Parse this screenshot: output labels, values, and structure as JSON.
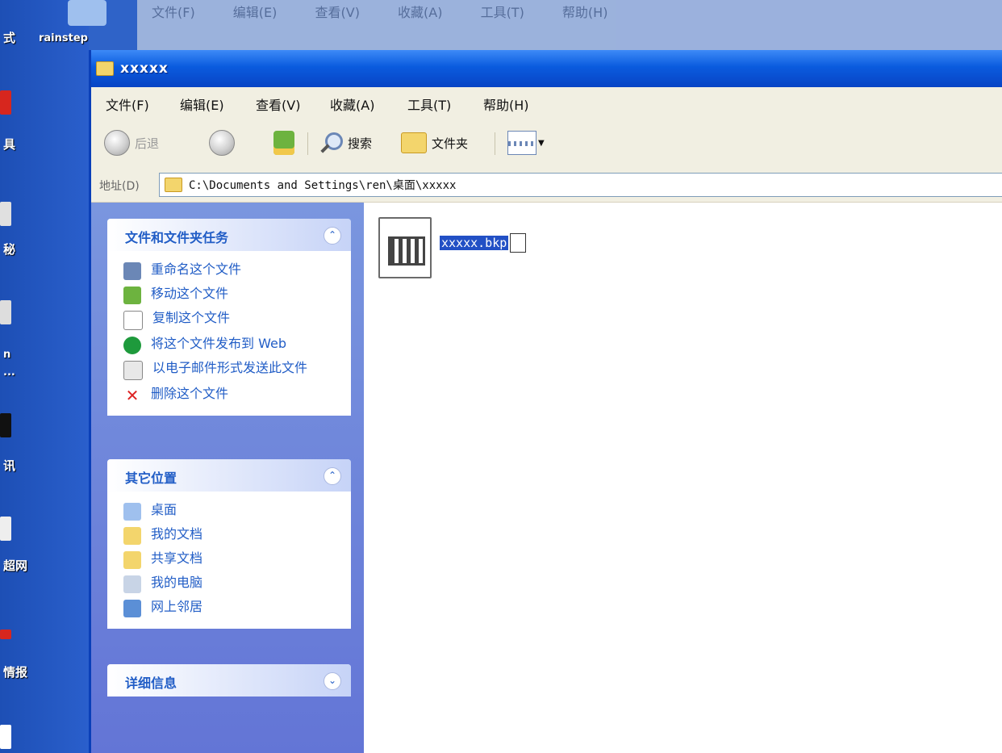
{
  "desktop": {
    "items": [
      {
        "label": "式"
      },
      {
        "label": "具"
      },
      {
        "label": "秘"
      },
      {
        "label": "n"
      },
      {
        "label": "..."
      },
      {
        "label": "讯"
      },
      {
        "label": "超网"
      },
      {
        "label": "情报"
      }
    ]
  },
  "background_window": {
    "top_icon_label": "rainstep",
    "menu": [
      "文件(F)",
      "编辑(E)",
      "查看(V)",
      "收藏(A)",
      "工具(T)",
      "帮助(H)"
    ]
  },
  "window": {
    "title": "xxxxx",
    "menu": [
      "文件(F)",
      "编辑(E)",
      "查看(V)",
      "收藏(A)",
      "工具(T)",
      "帮助(H)"
    ],
    "toolbar": {
      "back_label": "后退",
      "search_label": "搜索",
      "folders_label": "文件夹"
    },
    "address": {
      "label": "地址(D)",
      "value": "C:\\Documents and Settings\\ren\\桌面\\xxxxx"
    }
  },
  "taskpane": {
    "file_tasks": {
      "title": "文件和文件夹任务",
      "items": [
        {
          "label": "重命名这个文件",
          "icon": "rename-icon"
        },
        {
          "label": "移动这个文件",
          "icon": "move-icon"
        },
        {
          "label": "复制这个文件",
          "icon": "copy-icon"
        },
        {
          "label": "将这个文件发布到 Web",
          "icon": "web-publish-icon"
        },
        {
          "label": "以电子邮件形式发送此文件",
          "icon": "email-icon"
        },
        {
          "label": "删除这个文件",
          "icon": "delete-icon"
        }
      ]
    },
    "other_places": {
      "title": "其它位置",
      "items": [
        {
          "label": "桌面",
          "icon": "desktop-icon"
        },
        {
          "label": "我的文档",
          "icon": "my-documents-icon"
        },
        {
          "label": "共享文档",
          "icon": "shared-documents-icon"
        },
        {
          "label": "我的电脑",
          "icon": "my-computer-icon"
        },
        {
          "label": "网上邻居",
          "icon": "network-places-icon"
        }
      ]
    },
    "details": {
      "title": "详细信息"
    }
  },
  "fileview": {
    "file": {
      "name_editing": "xxxxx.bkp"
    }
  }
}
